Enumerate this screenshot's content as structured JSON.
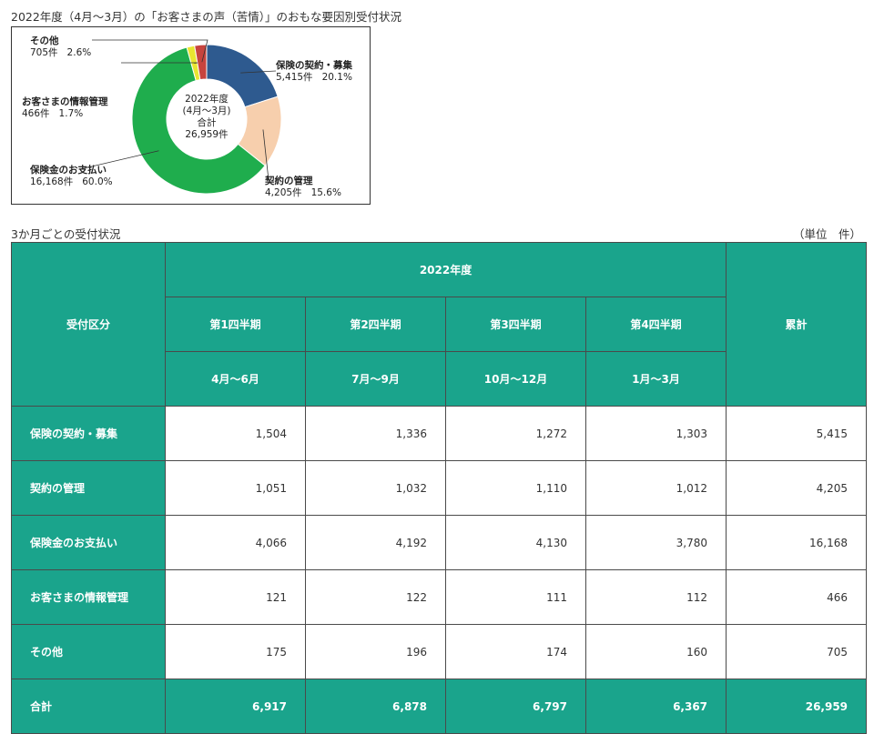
{
  "title": "2022年度（4月～3月）の「お客さまの声（苦情）」のおもな要因別受付状況",
  "chart_data": {
    "type": "pie",
    "title": "2022年度（4月～3月）の「お客さまの声（苦情）」のおもな要因別受付状況",
    "center": {
      "line1": "2022年度",
      "line2": "(4月～3月)",
      "line3": "合計",
      "line4": "26,959件"
    },
    "slices": [
      {
        "name": "保険の契約・募集",
        "count_label": "5,415件",
        "pct_label": "20.1%",
        "value": 20.1,
        "color": "#2e5a8f"
      },
      {
        "name": "契約の管理",
        "count_label": "4,205件",
        "pct_label": "15.6%",
        "value": 15.6,
        "color": "#f7cfad"
      },
      {
        "name": "保険金のお支払い",
        "count_label": "16,168件",
        "pct_label": "60.0%",
        "value": 60.0,
        "color": "#1fad4d"
      },
      {
        "name": "お客さまの情報管理",
        "count_label": "466件",
        "pct_label": "1.7%",
        "value": 1.7,
        "color": "#e9e531"
      },
      {
        "name": "その他",
        "count_label": "705件",
        "pct_label": "2.6%",
        "value": 2.6,
        "color": "#c7443e"
      }
    ]
  },
  "table": {
    "subtitle": "3か月ごとの受付状況",
    "unit": "（単位　件）",
    "header": {
      "category": "受付区分",
      "year": "2022年度",
      "total": "累計",
      "quarters": [
        {
          "name": "第1四半期",
          "period": "4月～6月"
        },
        {
          "name": "第2四半期",
          "period": "7月～9月"
        },
        {
          "name": "第3四半期",
          "period": "10月～12月"
        },
        {
          "name": "第4四半期",
          "period": "1月～3月"
        }
      ]
    },
    "rows": [
      {
        "label": "保険の契約・募集",
        "values": [
          "1,504",
          "1,336",
          "1,272",
          "1,303",
          "5,415"
        ]
      },
      {
        "label": "契約の管理",
        "values": [
          "1,051",
          "1,032",
          "1,110",
          "1,012",
          "4,205"
        ]
      },
      {
        "label": "保険金のお支払い",
        "values": [
          "4,066",
          "4,192",
          "4,130",
          "3,780",
          "16,168"
        ]
      },
      {
        "label": "お客さまの情報管理",
        "values": [
          "121",
          "122",
          "111",
          "112",
          "466"
        ]
      },
      {
        "label": "その他",
        "values": [
          "175",
          "196",
          "174",
          "160",
          "705"
        ]
      }
    ],
    "total_row": {
      "label": "合計",
      "values": [
        "6,917",
        "6,878",
        "6,797",
        "6,367",
        "26,959"
      ]
    }
  }
}
